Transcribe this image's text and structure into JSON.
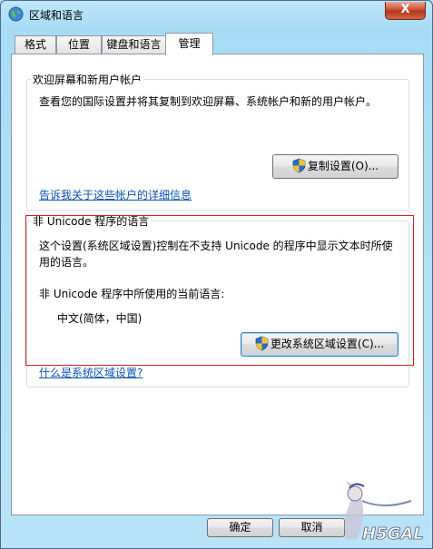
{
  "window": {
    "title": "区域和语言",
    "close_label": "X"
  },
  "tabs": [
    {
      "label": "格式"
    },
    {
      "label": "位置"
    },
    {
      "label": "键盘和语言"
    },
    {
      "label": "管理"
    }
  ],
  "welcome": {
    "title": "欢迎屏幕和新用户帐户",
    "description": "查看您的国际设置并将其复制到欢迎屏幕、系统帐户和新的用户帐户。",
    "copy_button": "复制设置(O)...",
    "details_link": "告诉我关于这些帐户的详细信息"
  },
  "non_unicode": {
    "title": "非 Unicode 程序的语言",
    "description_line1": "这个设置(系统区域设置)控制在不支持 Unicode 的程序中显示文本时所使",
    "description_line2": "用的语言。",
    "current_label": "非 Unicode 程序中所使用的当前语言:",
    "current_value": "中文(简体，中国)",
    "change_button": "更改系统区域设置(C)...",
    "help_link": "什么是系统区域设置?"
  },
  "footer": {
    "ok_button": "确定",
    "cancel_button": "取消"
  },
  "watermark": {
    "text": "H5GAL"
  },
  "colors": {
    "link": "#0a51b5",
    "highlight_border": "#d0201c",
    "title_bar": "#aee0f6"
  },
  "icons": {
    "app": "globe-icon",
    "shield": "uac-shield-icon",
    "close": "close-icon"
  }
}
